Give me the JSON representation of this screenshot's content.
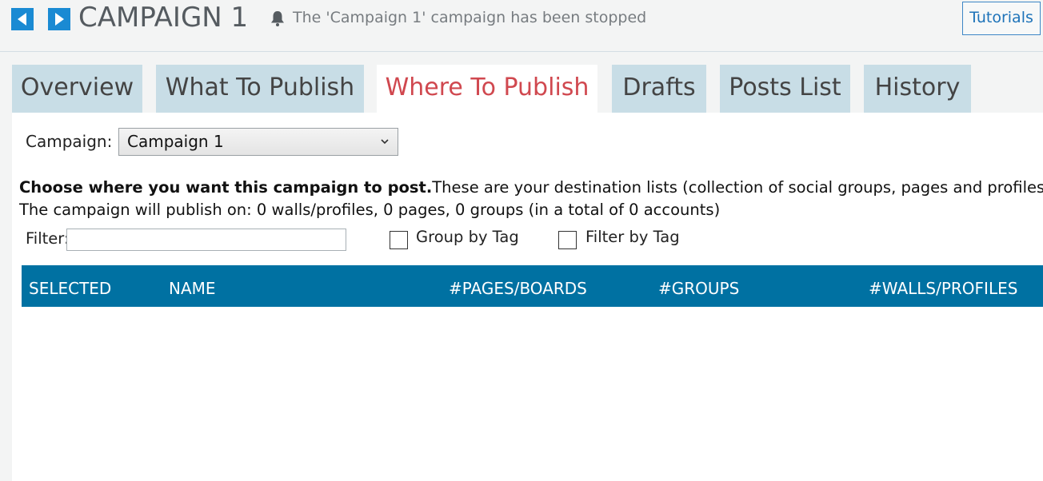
{
  "header": {
    "back_icon": "triangle-left-icon",
    "forward_icon": "triangle-right-icon",
    "title": "CAMPAIGN 1",
    "status_icon": "bell-icon",
    "status_text": "The 'Campaign 1' campaign has been stopped",
    "tutorials_label": "Tutorials"
  },
  "tabs": [
    {
      "label": "Overview",
      "active": false
    },
    {
      "label": "What To Publish",
      "active": false
    },
    {
      "label": "Where To Publish",
      "active": true
    },
    {
      "label": "Drafts",
      "active": false
    },
    {
      "label": "Posts List",
      "active": false
    },
    {
      "label": "History",
      "active": false
    }
  ],
  "form": {
    "campaign_label": "Campaign:",
    "campaign_value": "Campaign 1",
    "instructions_bold": "Choose where you want this campaign to post.",
    "instructions_rest": "These are your destination lists (collection of social groups, pages and profiles)",
    "summary": "The campaign will publish on: 0 walls/profiles, 0 pages, 0 groups (in a total of 0 accounts)",
    "filter_label": "Filter:",
    "filter_value": "",
    "group_by_tag_label": "Group by Tag",
    "filter_by_tag_label": "Filter by Tag"
  },
  "table": {
    "columns": [
      "SELECTED",
      "NAME",
      "#PAGES/BOARDS",
      "#GROUPS",
      "#WALLS/PROFILES"
    ],
    "rows": []
  },
  "colors": {
    "accent": "#1a8ad3",
    "active_tab_text": "#d0484f",
    "inactive_tab_bg": "#c8dde6",
    "table_header_bg": "#0071a2"
  }
}
